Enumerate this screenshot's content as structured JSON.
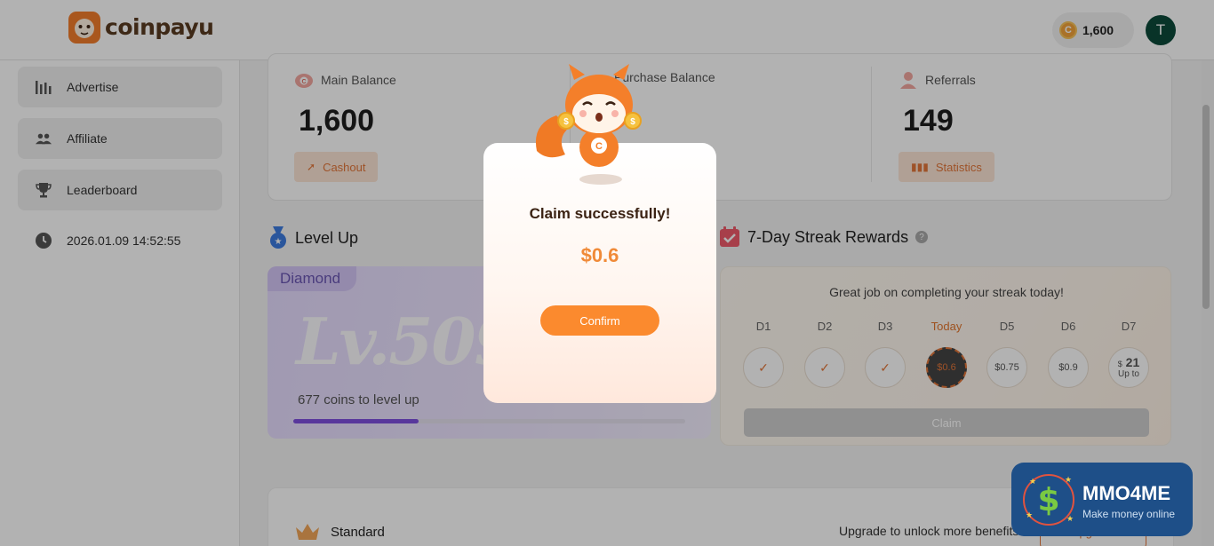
{
  "header": {
    "brand": "coinpayu",
    "coins": "1,600",
    "avatar_initial": "T"
  },
  "sidebar": {
    "items": [
      {
        "label": "Advertise",
        "icon": "bar-chart-icon"
      },
      {
        "label": "Affiliate",
        "icon": "users-icon"
      },
      {
        "label": "Leaderboard",
        "icon": "trophy-icon"
      },
      {
        "label": "2026.01.09 14:52:55",
        "icon": "clock-icon"
      }
    ]
  },
  "balances": {
    "main": {
      "label": "Main Balance",
      "value": "1,600",
      "button": "Cashout"
    },
    "purchase": {
      "label": "Purchase Balance"
    },
    "referrals": {
      "label": "Referrals",
      "value": "149",
      "button": "Statistics"
    }
  },
  "level": {
    "title": "Level Up",
    "tier": "Diamond",
    "level": "Lv.509",
    "coins_to_level": "677 coins to level up",
    "progress": 0.32
  },
  "streak": {
    "title": "7-Day Streak Rewards",
    "message": "Great job on completing your streak today!",
    "days": [
      {
        "label": "D1",
        "reward": "✓"
      },
      {
        "label": "D2",
        "reward": "✓"
      },
      {
        "label": "D3",
        "reward": "✓"
      },
      {
        "label": "Today",
        "reward": "$0.6"
      },
      {
        "label": "D5",
        "reward": "$0.75"
      },
      {
        "label": "D6",
        "reward": "$0.9"
      },
      {
        "label": "D7",
        "reward_top": "21",
        "reward_currency": "$",
        "reward_bottom": "Up to"
      }
    ],
    "claim_label": "Claim"
  },
  "standard": {
    "title": "Standard",
    "message": "Upgrade to unlock more benefits",
    "button": "Upgrade"
  },
  "modal": {
    "title": "Claim successfully!",
    "amount": "$0.6",
    "confirm": "Confirm"
  },
  "watermark": {
    "title": "MMO4ME",
    "subtitle": "Make money online"
  },
  "colors": {
    "accent": "#fb8a2e",
    "brand": "#5a3b22",
    "level_fill": "#7e4fe0",
    "avatar": "#0c4a3a"
  }
}
